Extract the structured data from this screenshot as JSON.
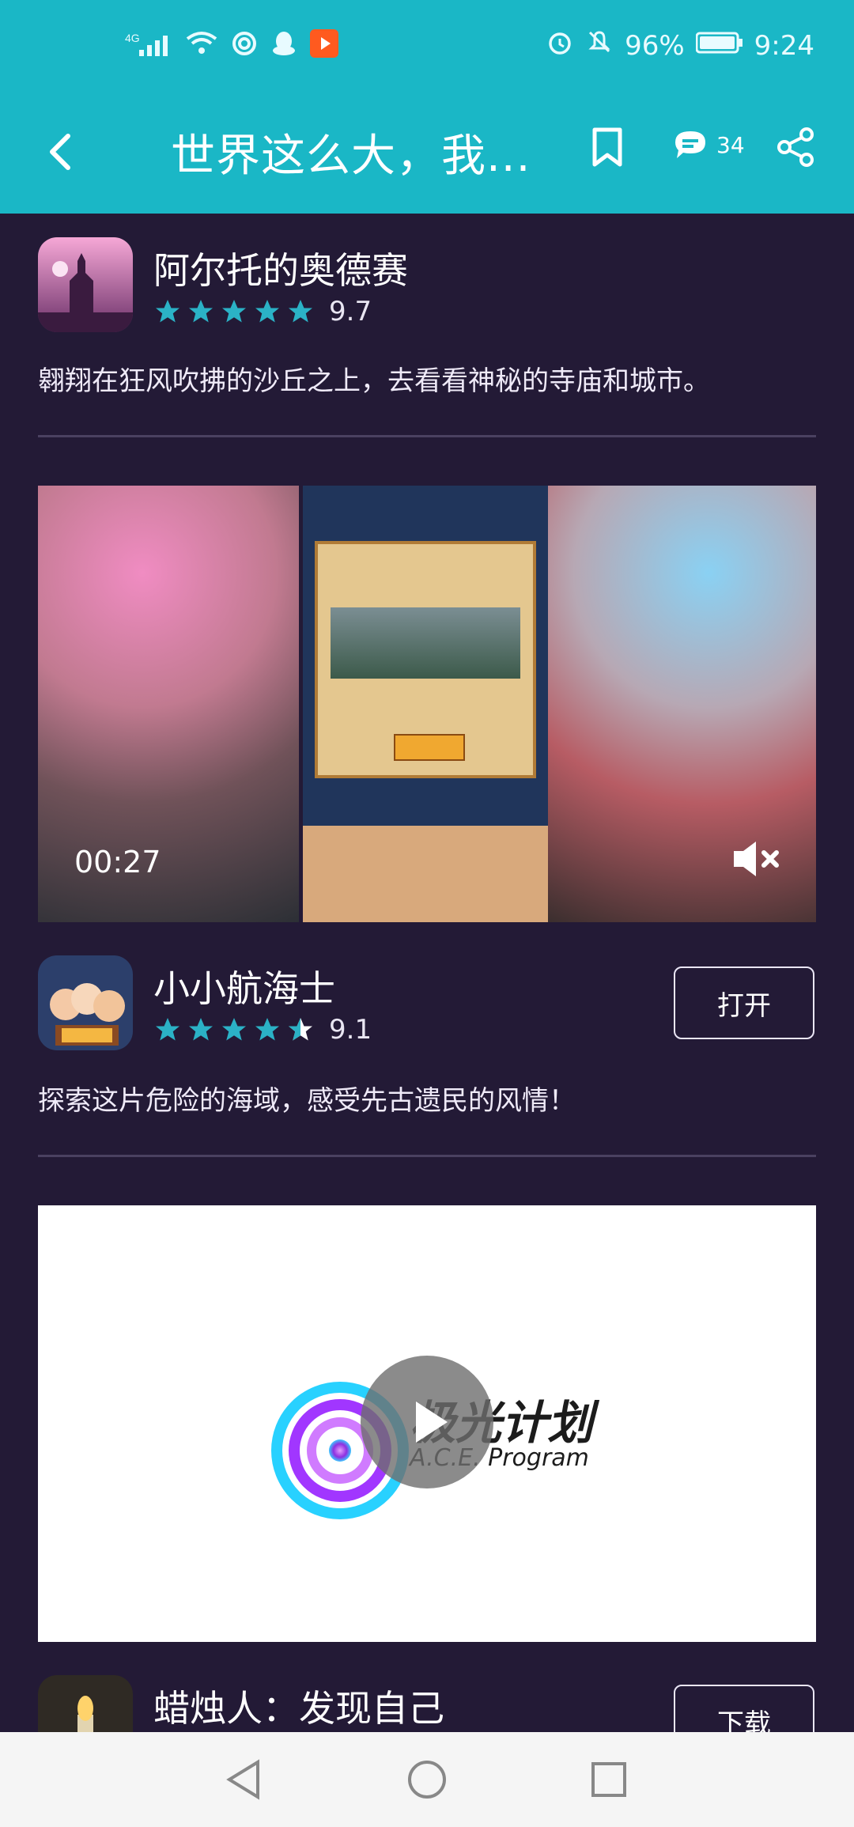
{
  "status_bar": {
    "network": "4G",
    "battery": "96%",
    "time": "9:24"
  },
  "header": {
    "title": "世界这么大，我...",
    "comment_count": "34",
    "colors": {
      "accent": "#1ab7c6"
    }
  },
  "apps": [
    {
      "name": "阿尔托的奥德赛",
      "rating": "9.7",
      "stars": 5,
      "desc": "翱翔在狂风吹拂的沙丘之上，去看看神秘的寺庙和城市。"
    },
    {
      "name": "小小航海士",
      "rating": "9.1",
      "stars": 4.5,
      "desc": "探索这片危险的海域，感受先古遗民的风情！",
      "action": "打开"
    },
    {
      "name": "蜡烛人：发现自己",
      "action": "下载"
    }
  ],
  "video": {
    "time": "00:27",
    "mute_icon": "volume-mute-icon"
  },
  "promo": {
    "brand_cn": "极光计划",
    "brand_en": "A.C.E. Program"
  },
  "icons": {
    "back": "back-icon",
    "bookmark": "bookmark-icon",
    "comment": "comment-icon",
    "share": "share-icon",
    "star": "star-icon",
    "play": "play-icon"
  }
}
